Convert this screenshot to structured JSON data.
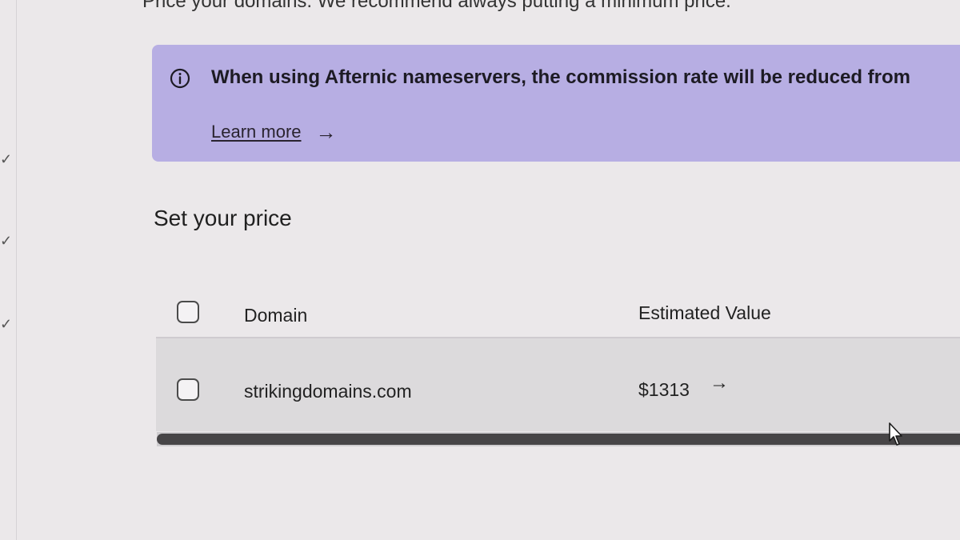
{
  "header": {
    "intro_text": "Price your domains. We recommend always putting a minimum price."
  },
  "banner": {
    "icon": "info-icon",
    "message": "When using Afternic nameservers, the commission rate will be reduced from",
    "link_label": "Learn more",
    "link_arrow": "→",
    "background_color": "#b7aee3"
  },
  "section": {
    "title": "Set your price"
  },
  "table": {
    "columns": [
      "Domain",
      "Estimated Value"
    ],
    "rows": [
      {
        "domain": "strikingdomains.com",
        "estimated_value": "$1313",
        "arrow": "→"
      }
    ]
  },
  "sidebar": {
    "check_glyph": "✓"
  }
}
